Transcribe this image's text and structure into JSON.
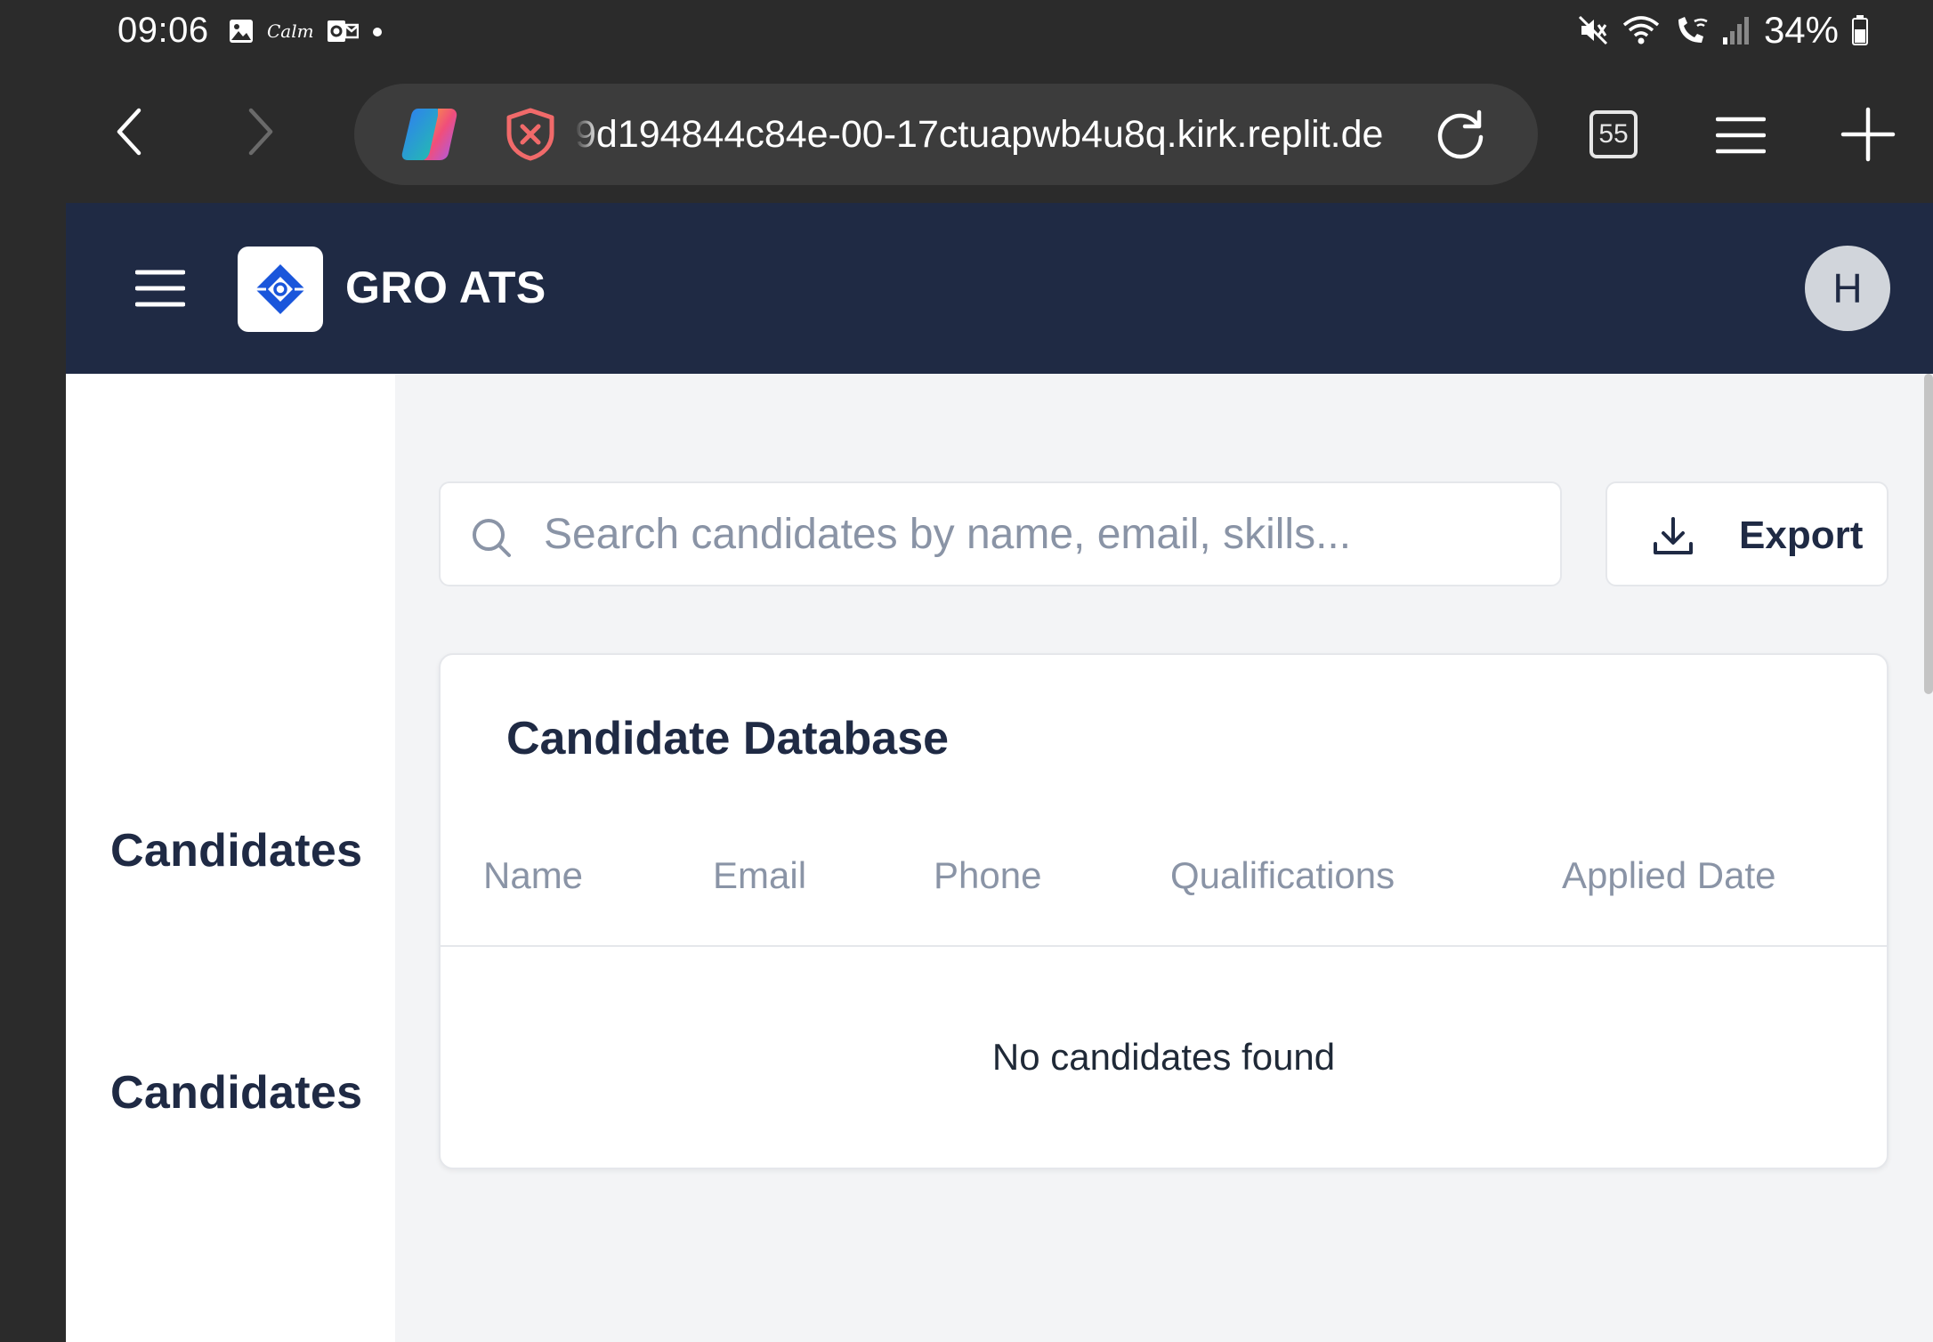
{
  "status_bar": {
    "time": "09:06",
    "calm_label": "Calm",
    "battery": "34%",
    "left_icons": [
      "image-icon",
      "calm-icon",
      "outlook-icon",
      "dot-icon"
    ],
    "right_icons": [
      "mute-icon",
      "wifi-icon",
      "wifi-calling-icon",
      "signal-icon",
      "battery-icon"
    ]
  },
  "browser": {
    "url": "9d194844c84e-00-17ctuapwb4u8q.kirk.replit.de",
    "tab_count": "55",
    "icons": [
      "back-icon",
      "forward-icon",
      "copilot-icon",
      "shield-icon",
      "reload-icon",
      "tabs-icon",
      "menu-icon",
      "new-tab-icon"
    ]
  },
  "app": {
    "title": "GRO ATS",
    "avatar_initial": "H",
    "accent_color": "#1f2a44",
    "logo_color": "#1a56db"
  },
  "sidebar": {
    "items": [
      {
        "label": "Candidates"
      },
      {
        "label": "Candidates"
      }
    ]
  },
  "search": {
    "placeholder": "Search candidates by name, email, skills...",
    "value": ""
  },
  "toolbar": {
    "export_label": "Export"
  },
  "table": {
    "title": "Candidate Database",
    "columns": [
      "Name",
      "Email",
      "Phone",
      "Qualifications",
      "Applied Date"
    ],
    "rows": [],
    "empty_message": "No candidates found"
  }
}
